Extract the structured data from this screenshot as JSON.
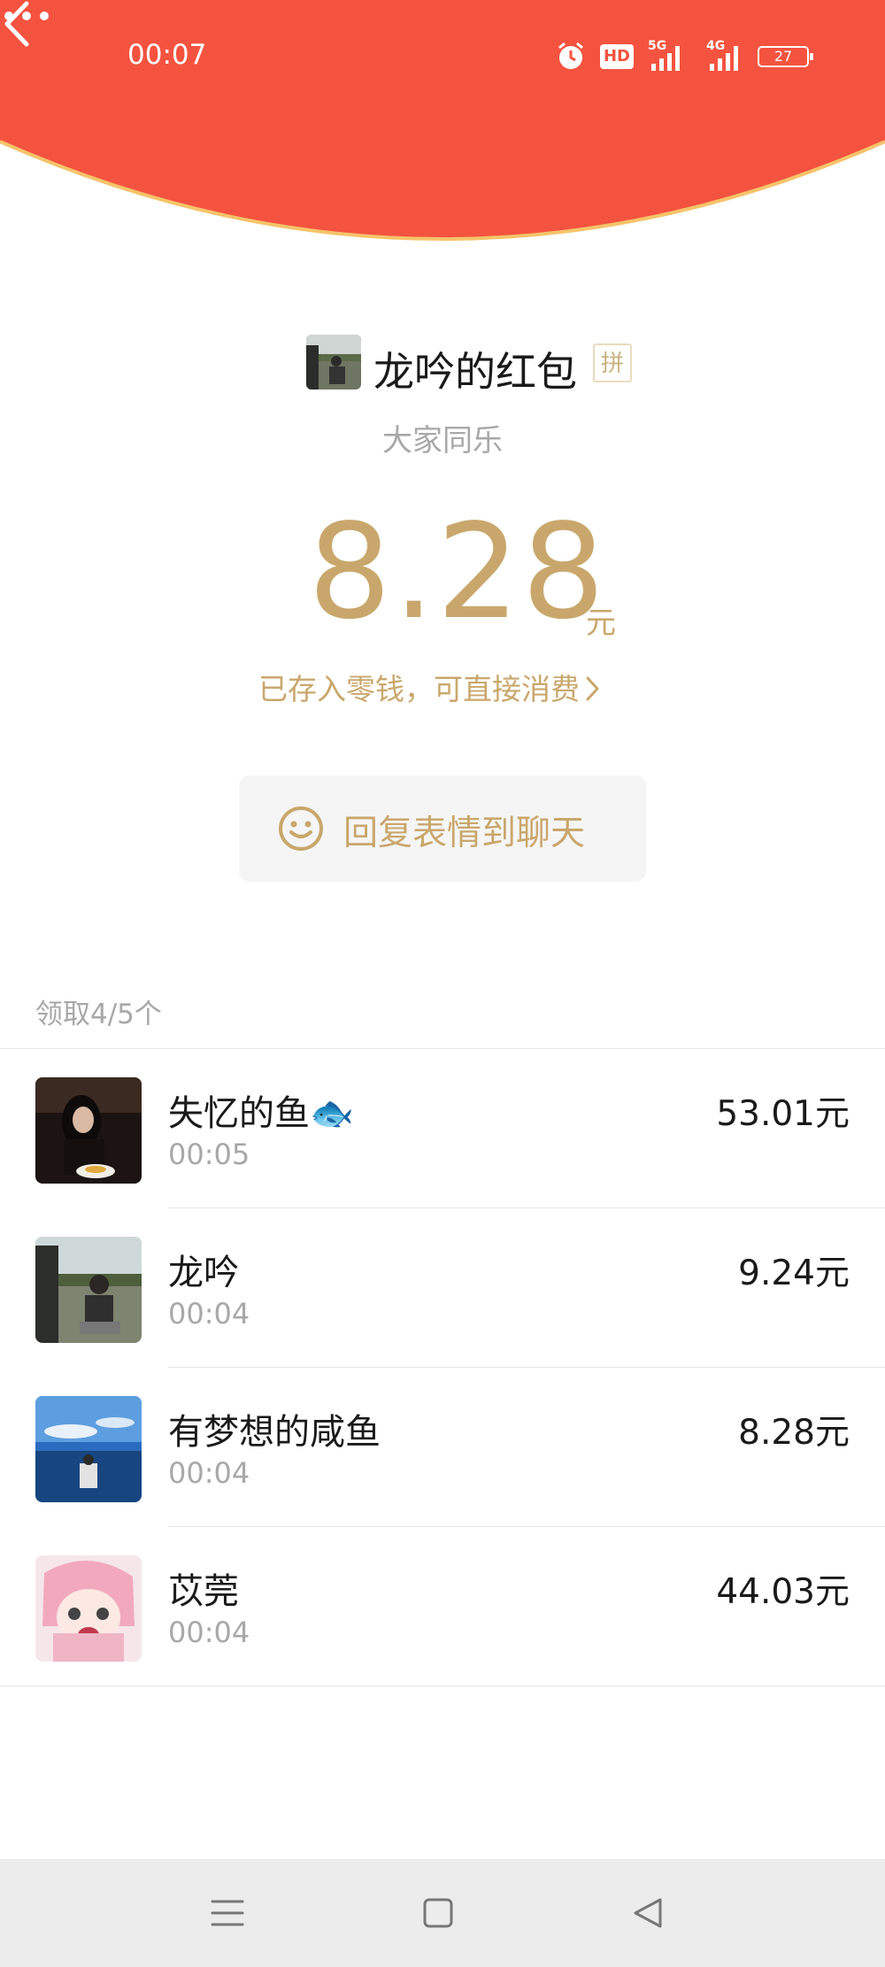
{
  "status_bar": {
    "time": "00:07",
    "icons": [
      "alarm-icon",
      "hd-icon",
      "5g-signal-icon",
      "4g-signal-icon",
      "battery-icon"
    ],
    "hd_label": "HD",
    "net1_label": "5G",
    "net2_label": "4G",
    "battery_level": "27"
  },
  "colors": {
    "header_red": "#f4533f",
    "header_edge": "#f6c36a",
    "gold": "#c9a76c",
    "grey_text": "#a8a8a8"
  },
  "header": {
    "back_icon": "chevron-left-icon",
    "more_icon": "more-dots-icon"
  },
  "packet": {
    "sender_name": "龙吟的红包",
    "type_badge": "拼",
    "greeting": "大家同乐",
    "amount": "8.28",
    "unit": "元",
    "deposit_note": "已存入零钱，可直接消费",
    "deposit_chevron": "›"
  },
  "reply_button": {
    "icon": "smile-icon",
    "label": "回复表情到聊天"
  },
  "received": {
    "summary": "领取4/5个",
    "items": [
      {
        "name": "失忆的鱼🐟",
        "time": "00:05",
        "amount": "53.01元"
      },
      {
        "name": "龙吟",
        "time": "00:04",
        "amount": "9.24元"
      },
      {
        "name": "有梦想的咸鱼",
        "time": "00:04",
        "amount": "8.28元"
      },
      {
        "name": "苡莞",
        "time": "00:04",
        "amount": "44.03元"
      }
    ]
  },
  "nav_bar": {
    "icons": [
      "menu-icon",
      "home-square-icon",
      "back-triangle-icon"
    ]
  }
}
